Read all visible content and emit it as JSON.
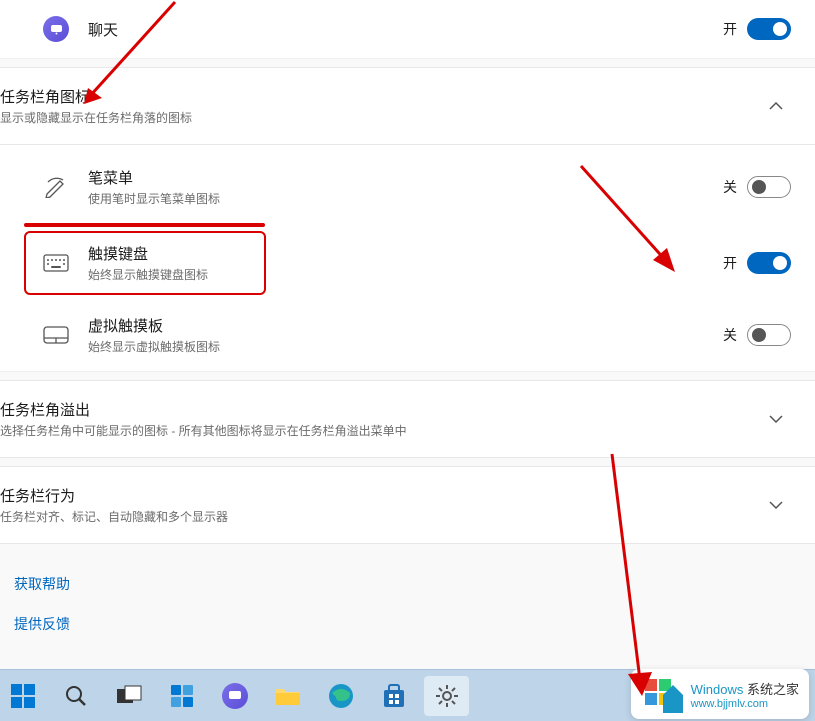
{
  "chat": {
    "title": "聊天",
    "toggle_label": "开",
    "toggle_state": "on"
  },
  "section_corner_icons": {
    "title": "任务栏角图标",
    "subtitle": "显示或隐藏显示在任务栏角落的图标",
    "expanded": true
  },
  "pen_menu": {
    "title": "笔菜单",
    "subtitle": "使用笔时显示笔菜单图标",
    "toggle_label": "关",
    "toggle_state": "off"
  },
  "touch_keyboard": {
    "title": "触摸键盘",
    "subtitle": "始终显示触摸键盘图标",
    "toggle_label": "开",
    "toggle_state": "on"
  },
  "virtual_touchpad": {
    "title": "虚拟触摸板",
    "subtitle": "始终显示虚拟触摸板图标",
    "toggle_label": "关",
    "toggle_state": "off"
  },
  "section_overflow": {
    "title": "任务栏角溢出",
    "subtitle": "选择任务栏角中可能显示的图标 - 所有其他图标将显示在任务栏角溢出菜单中",
    "expanded": false
  },
  "section_behavior": {
    "title": "任务栏行为",
    "subtitle": "任务栏对齐、标记、自动隐藏和多个显示器",
    "expanded": false
  },
  "help": {
    "get_help": "获取帮助",
    "feedback": "提供反馈"
  },
  "watermark": {
    "brand_prefix": "Windows",
    "brand_suffix": " 系统之家",
    "url": "www.bjjmlv.com"
  }
}
